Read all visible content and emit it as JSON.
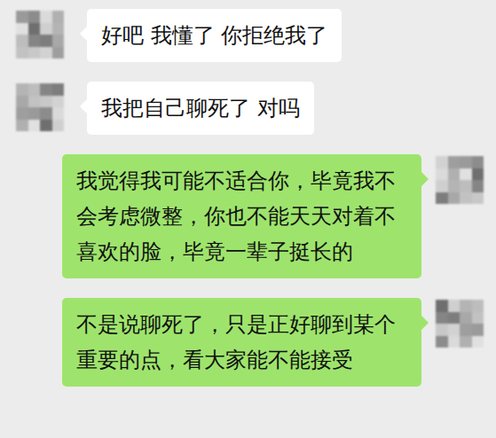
{
  "messages": [
    {
      "kind": "received",
      "text": "好吧 我懂了 你拒绝我了"
    },
    {
      "kind": "received",
      "text": "我把自己聊死了 对吗"
    },
    {
      "kind": "sent",
      "text": "我觉得我可能不适合你，毕竟我不会考虑微整，你也不能天天对着不喜欢的脸，毕竟一辈子挺长的"
    },
    {
      "kind": "sent",
      "text": "不是说聊死了，只是正好聊到某个重要的点，看大家能不能接受"
    }
  ]
}
